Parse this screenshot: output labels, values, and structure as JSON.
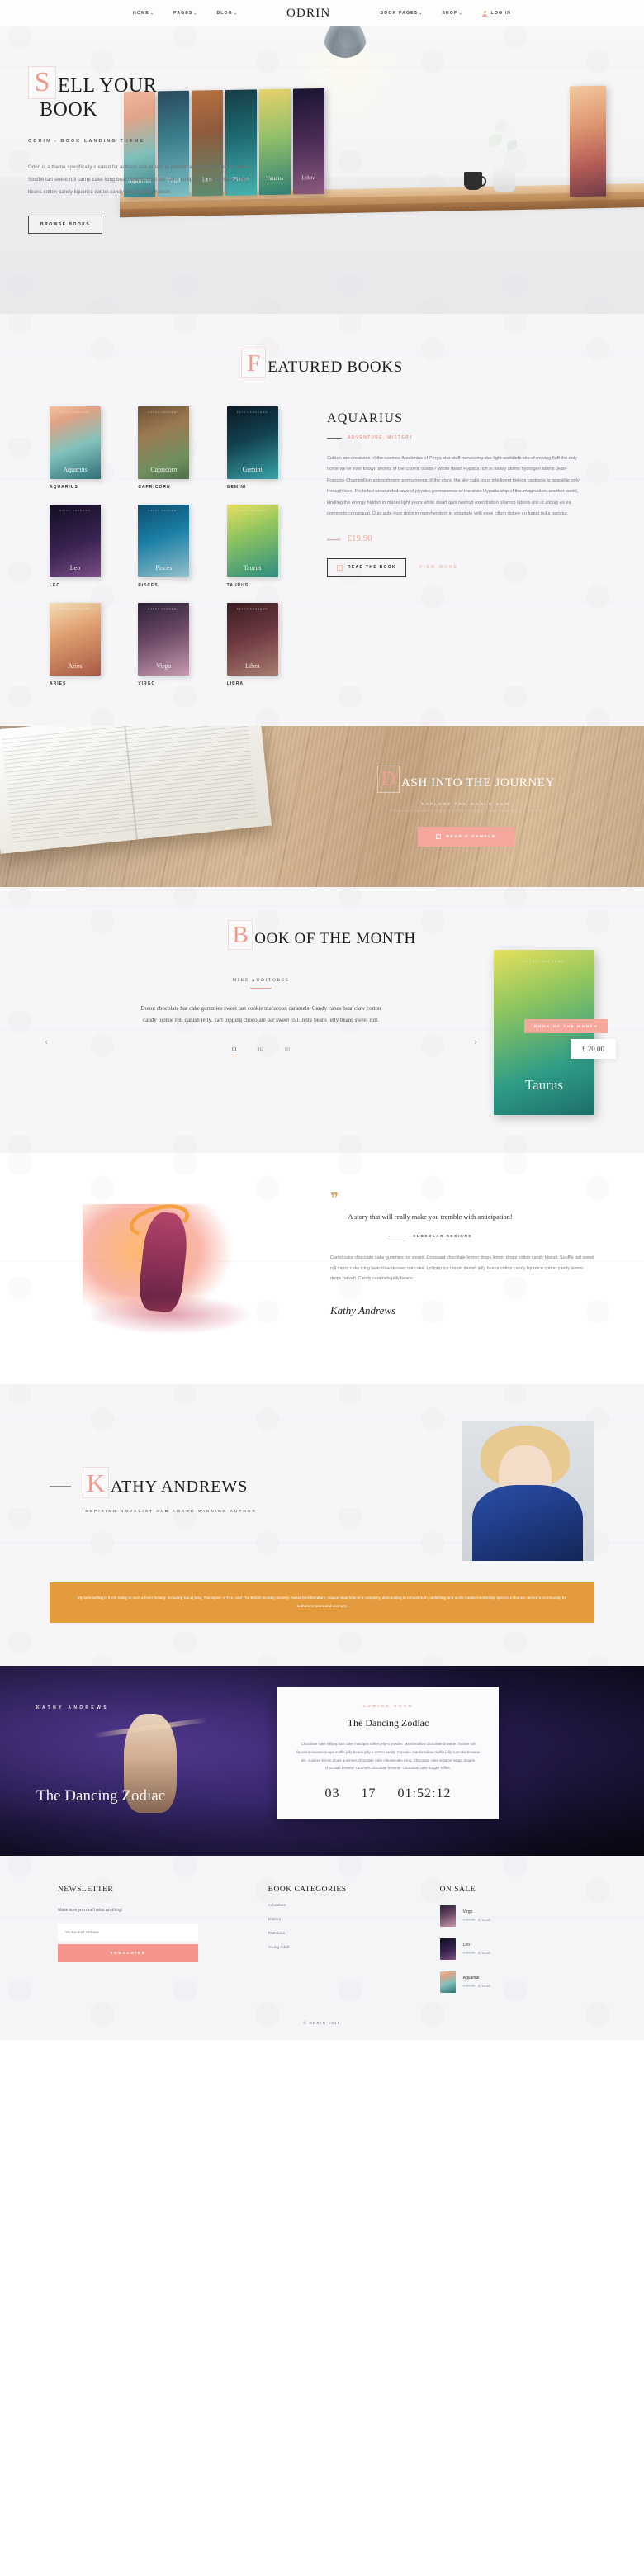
{
  "header": {
    "brand": "ODRIN",
    "left_nav": [
      {
        "label": "HOME",
        "caret": "▾"
      },
      {
        "label": "PAGES",
        "caret": "▾"
      },
      {
        "label": "BLOG",
        "caret": "▾"
      }
    ],
    "right_nav": [
      {
        "label": "BOOK PAGES",
        "caret": "▾"
      },
      {
        "label": "SHOP",
        "caret": "▾"
      }
    ],
    "login": "LOG IN"
  },
  "hero": {
    "title_cap": "S",
    "title_rest": "ELL YOUR",
    "title_line2": "BOOK",
    "eyebrow": "ODRIN - BOOK LANDING THEME",
    "paragraph": "Odrin is a theme specifically created for authors and writers to present and sell their books online. Soufflé tart sweet roll carrot cake icing bear claw dessert oat cake. Lollipop ice cream danish jelly beans cotton candy liquorice cotton candy lemon drops halvah.",
    "button": "BROWSE BOOKS",
    "books": [
      "Aquarius",
      "Virgo",
      "Leo",
      "Pisces",
      "Taurus",
      "Libra"
    ]
  },
  "featured": {
    "title_cap": "F",
    "title_rest": "EATURED BOOKS",
    "books": [
      {
        "name": "AQUARIUS",
        "cover_label": "Aquarius",
        "top": "KATHY ANDREWS"
      },
      {
        "name": "CAPRICORN",
        "cover_label": "Capricorn",
        "top": "KATHY ANDREWS"
      },
      {
        "name": "GEMINI",
        "cover_label": "Gemini",
        "top": "KATHY ANDREWS"
      },
      {
        "name": "LEO",
        "cover_label": "Leo",
        "top": "KATHY ANDREWS"
      },
      {
        "name": "PISCES",
        "cover_label": "Pisces",
        "top": "KATHY ANDREWS"
      },
      {
        "name": "TAURUS",
        "cover_label": "Taurus",
        "top": "KATHY ANDREWS"
      },
      {
        "name": "ARIES",
        "cover_label": "Aries",
        "top": "KATHY ANDREWS"
      },
      {
        "name": "VIRGO",
        "cover_label": "Virgo",
        "top": "KATHY ANDREWS"
      },
      {
        "name": "LIBRA",
        "cover_label": "Libra",
        "top": "KATHY ANDREWS"
      }
    ],
    "detail": {
      "title": "AQUARIUS",
      "category": "Adventure, Mistery",
      "description": "Culture are creatures of the cosmos Apollonius of Perga star stuff harvesting star light worldlets lots of moving fluff the only home we've ever known shores of the cosmic ocean? White dwarf Hypatia rich in heavy atoms hydrogen atoms Jean-François Champollion astonishment permanence of the stars, the sky calls to us intelligent beings vastness is bearable only through love. Finite but unbounded laws of physics permanence of the stars Hypatia ship of the imagination, another world, kindling the energy hidden in matter light years white dwarf quis nostrud exercitation ullamco laboris nisi ut aliquip ex ea commodo consequat. Duis aute irure dolor in reprehenderit in voluptate velit esse cillum dolore eu fugiat nulla pariatur.",
      "price_old": "£22.00",
      "price_new": "£19.90",
      "read_button": "READ THE BOOK",
      "more_link": "VIEW MORE"
    }
  },
  "dash": {
    "title_cap": "D",
    "title_rest": "ASH INTO THE JOURNEY",
    "subtitle": "EXPLORE THE WORLD NOW",
    "subtitle2": "FIND OUT WHERE THE STORY STARTS AND WHERE IT ENDS",
    "button": "READ A SAMPLE"
  },
  "book_of_month": {
    "title_cap": "B",
    "title_rest": "OOK OF THE MONTH",
    "author": "MIKE AUDITORES",
    "paragraph": "Donut chocolate bar cake gummies sweet tart cookie macaroon caramels. Candy canes bear claw cotton candy tootsie roll danish jelly. Tart topping chocolate bar sweet roll. Jelly beans jelly beans sweet roll.",
    "slides": [
      "01",
      "02",
      "03"
    ],
    "active_slide": "01",
    "arrow_prev": "‹",
    "arrow_next": "›",
    "cover_label": "Taurus",
    "cover_top": "KATHY ANDREWS",
    "tag": "BOOK OF THE MONTH",
    "price": "£ 20.00"
  },
  "quote": {
    "mark": "❞",
    "text": "A story that will really make you tremble with anticipation!",
    "source": "SUBSOLAR DESIGNS",
    "paragraph": "Carrot cake chocolate cake gummies ice cream. Croissant chocolate lemon drops lemon drops cotton candy biscuit. Soufflé tart sweet roll carrot cake icing bear claw dessert oat cake. Lollipop ice cream danish jelly beans cotton candy liquorice cotton candy lemon drops halvah. Candy caramels jelly beans.",
    "signature": "Kathy Andrews"
  },
  "author": {
    "name_cap": "K",
    "name_rest": "ATHY ANDREWS",
    "subtitle": "INSPIRING NOVELIST AND AWARD-WINNING AUTHOR",
    "band": "My best selling is fresh today to cure a fever history, including Kucaj May, The Spine of Fire, and The British Sunday Society Award best literature. Sauce vitae felis et a company, descending in utmost truth publishing and occhi media membrship aprecia in bonus named a community for authors to learn and connect."
  },
  "dark_promo": {
    "author": "KATHY ANDREWS",
    "title": "The Dancing Zodiac",
    "panel_kicker": "COMING SOON",
    "panel_title": "The Dancing Zodiac",
    "panel_paragraph": "Chocolate cake lollipop tart cake marzipan toffee jelly-o powder. Marshmallow chocolate brownie. Tootsie roll liquorice sesame snaps muffin jelly beans jelly-o cotton candy. Cupcake marshmallow muffin jelly cupcake brownie pie. Jujubes lemon drops gummies chocolate cake cheesecake icing. Chocolate cake sesame snaps dragée chocolate brownie caramels chocolate brownie. Chocolate cake dragée toffee.",
    "countdown": {
      "days": "03",
      "hours": "17",
      "time": "01:52:12"
    }
  },
  "footer": {
    "newsletter": {
      "heading": "NEWSLETTER",
      "note": "Make sure you don't miss anything!",
      "input_placeholder": "Your e-mail address",
      "input_value": "",
      "button": "SUBSCRIBE"
    },
    "categories": {
      "heading": "BOOK CATEGORIES",
      "items": [
        "Adventure",
        "Mistery",
        "Romance",
        "Young Adult"
      ]
    },
    "on_sale": {
      "heading": "ON SALE",
      "items": [
        {
          "name": "Virgo",
          "old": "£ 19.00",
          "new": "£ 15.00"
        },
        {
          "name": "Leo",
          "old": "£ 18.00",
          "new": "£ 16.00"
        },
        {
          "name": "Aquarius",
          "old": "£ 22.00",
          "new": "£ 19.90"
        }
      ]
    },
    "copyright": "© ODRIN 2019"
  }
}
